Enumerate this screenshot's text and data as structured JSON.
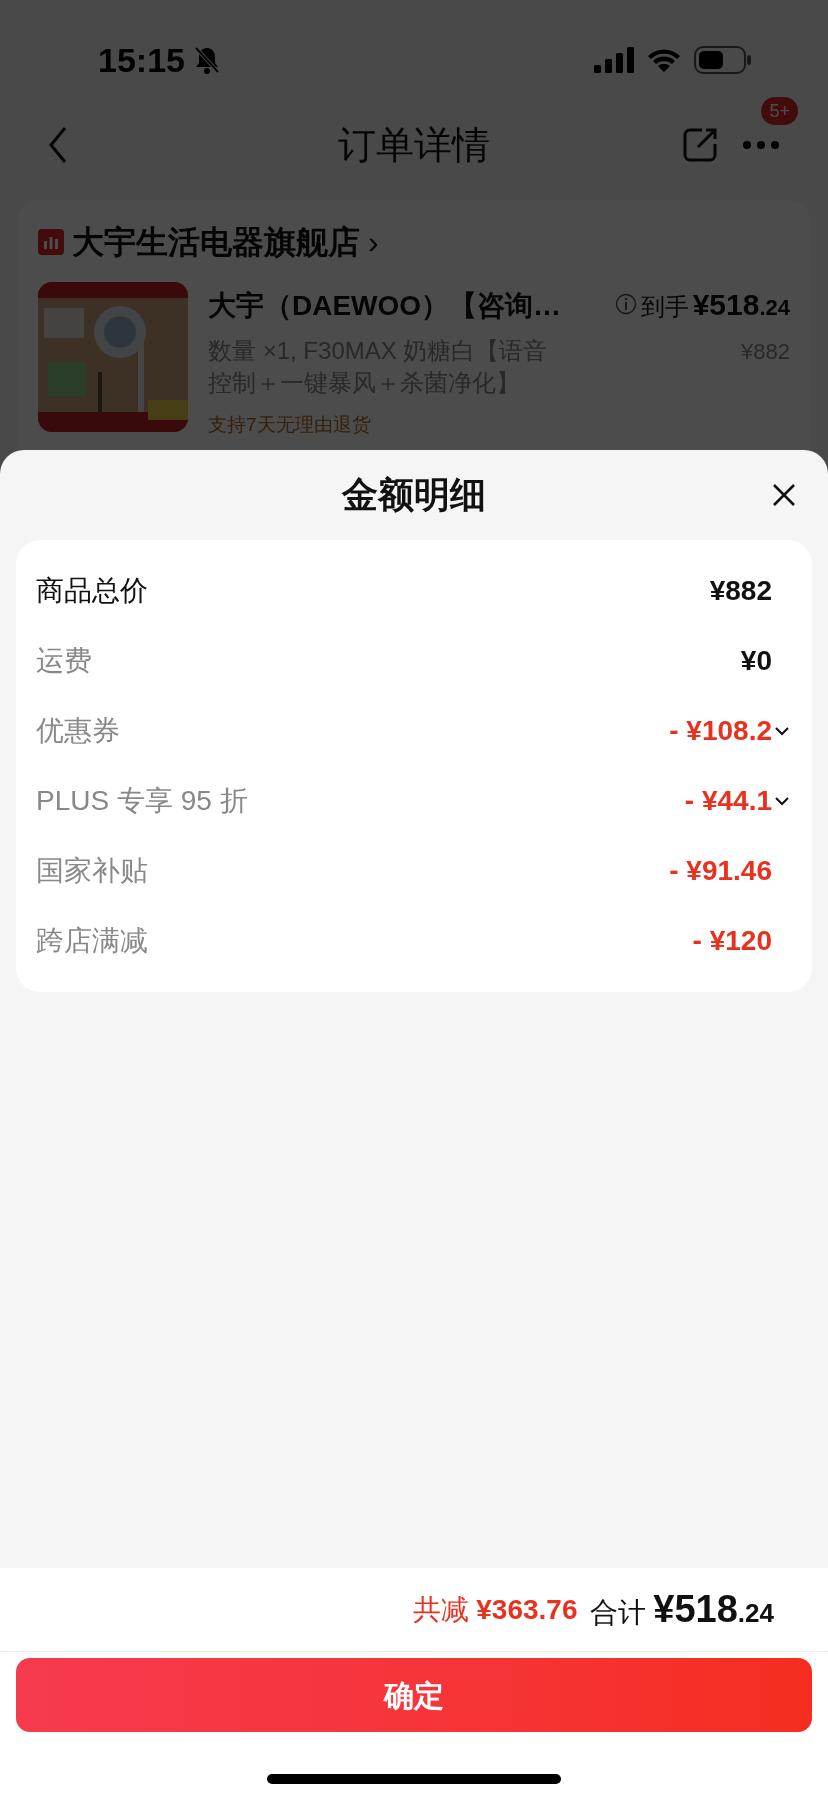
{
  "status_bar": {
    "time": "15:15"
  },
  "nav": {
    "title": "订单详情",
    "badge": "5+"
  },
  "store": {
    "name": "大宇生活电器旗舰店",
    "chevron": "›"
  },
  "product": {
    "title": "大宇（DAEWOO）【咨询…",
    "price_label": "到手",
    "price_int": "¥518",
    "price_dec": ".24",
    "spec": "数量 ×1, F30MAX 奶糖白【语音控制＋一键暴风＋杀菌净化】",
    "original_price": "¥882",
    "return_policy": "支持7天无理由退货"
  },
  "sheet": {
    "title": "金额明细",
    "rows": [
      {
        "label": "商品总价",
        "value": "¥882",
        "kind": "total",
        "expandable": false
      },
      {
        "label": "运费",
        "value": "¥0",
        "kind": "plain",
        "expandable": false
      },
      {
        "label": "优惠券",
        "value": "- ¥108.2",
        "kind": "discount",
        "expandable": true
      },
      {
        "label": "PLUS 专享 95 折",
        "value": "- ¥44.1",
        "kind": "discount",
        "expandable": true
      },
      {
        "label": "国家补贴",
        "value": "- ¥91.46",
        "kind": "discount",
        "expandable": false
      },
      {
        "label": "跨店满减",
        "value": "- ¥120",
        "kind": "discount",
        "expandable": false
      }
    ],
    "summary": {
      "saved_label": "共减",
      "saved": "¥363.76",
      "total_label": "合计",
      "total_int": "¥518",
      "total_dec": ".24"
    },
    "confirm": "确定"
  }
}
